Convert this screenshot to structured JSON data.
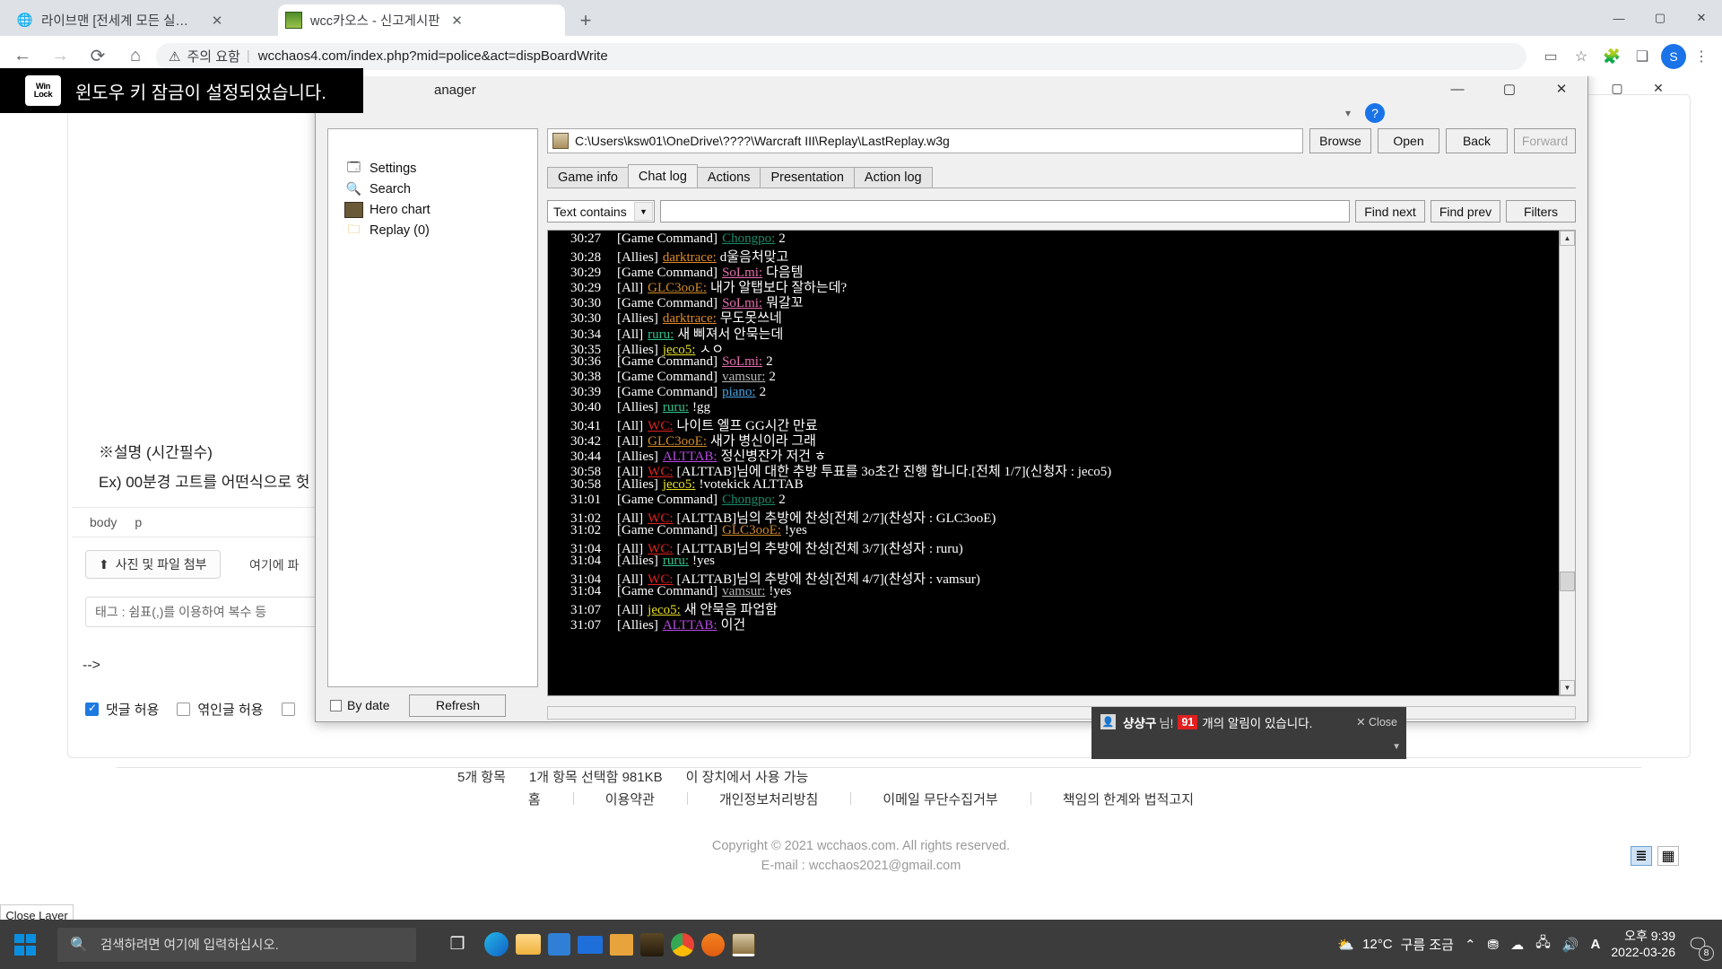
{
  "browser": {
    "tabs": [
      {
        "title": "라이브맨 [전세계 모든 실시간 스...",
        "favicon": "globe-icon",
        "active": false
      },
      {
        "title": "wcc카오스 - 신고게시판",
        "favicon": "site-icon",
        "active": true
      }
    ],
    "new_tab_label": "+",
    "window_controls": {
      "minimize": "—",
      "maximize": "▢",
      "close": "✕"
    },
    "nav": {
      "back": "←",
      "forward": "→",
      "reload": "⟳",
      "home": "⌂"
    },
    "omnibox": {
      "security_icon": "warning-triangle-icon",
      "security_label": "주의 요함",
      "url": "wcchaos4.com/index.php?mid=police&act=dispBoardWrite"
    },
    "omnibox_right_icons": [
      "payment-icon",
      "bookmark-star-icon",
      "extensions-icon",
      "split-view-icon"
    ],
    "profile_initial": "S"
  },
  "winlock_toast": {
    "badge_line1": "Win",
    "badge_line2": "Lock",
    "message": "윈도우 키 잠금이 설정되었습니다."
  },
  "page": {
    "note_title": "※설명 (시간필수)",
    "note_example": "Ex) 00분경 고트를 어떤식으로 헛",
    "body_tag": "body",
    "body_tag2": "p",
    "attach_button": "사진 및 파일 첨부",
    "attach_hint": "여기에 파",
    "tag_placeholder": "태그 : 쉼표(,)를 이용하여 복수 등",
    "arrow_text": "-->",
    "checkboxes": [
      {
        "label": "댓글 허용",
        "checked": true
      },
      {
        "label": "엮인글 허용",
        "checked": false
      },
      {
        "label": "",
        "checked": false
      }
    ],
    "status": [
      "5개 항목",
      "1개 항목 선택함 981KB",
      "이 장치에서 사용 가능"
    ],
    "footer_links": [
      "홈",
      "이용약관",
      "개인정보처리방침",
      "이메일 무단수집거부",
      "책임의 한계와 법적고지"
    ],
    "copyright_line1": "Copyright © 2021 wcchaos.com. All rights reserved.",
    "copyright_line2": "E-mail : wcchaos2021@gmail.com",
    "close_layer": "Close Layer"
  },
  "w3g": {
    "title": "anager",
    "window_controls": {
      "minimize": "—",
      "maximize": "▢",
      "close": "✕"
    },
    "tree": [
      {
        "label": "Settings",
        "icon": "settings-icon"
      },
      {
        "label": "Search",
        "icon": "magnifier-icon"
      },
      {
        "label": "Hero chart",
        "icon": "hero-chart-icon"
      },
      {
        "label": "Replay (0)",
        "icon": "folder-icon"
      }
    ],
    "by_date_label": "By date",
    "by_date_checked": false,
    "refresh_label": "Refresh",
    "path": "C:\\Users\\ksw01\\OneDrive\\????\\Warcraft III\\Replay\\LastReplay.w3g",
    "path_buttons": [
      {
        "label": "Browse",
        "disabled": false
      },
      {
        "label": "Open",
        "disabled": false
      },
      {
        "label": "Back",
        "disabled": false
      },
      {
        "label": "Forward",
        "disabled": true
      }
    ],
    "tabs": [
      {
        "label": "Game info",
        "active": false
      },
      {
        "label": "Chat log",
        "active": true
      },
      {
        "label": "Actions",
        "active": false
      },
      {
        "label": "Presentation",
        "active": false
      },
      {
        "label": "Action log",
        "active": false
      }
    ],
    "filter": {
      "mode": "Text contains",
      "query": "",
      "buttons": [
        "Find next",
        "Find prev",
        "Filters"
      ]
    },
    "chat_colors": {
      "darktrace": "#e08b28",
      "SoLmi": "#e86fb0",
      "GLC3ooE": "#d08a28",
      "ruru": "#2fc48e",
      "jeco5": "#e8e020",
      "vamsur": "#b8b8b8",
      "piano": "#4aa8e8",
      "WC": "#e02020",
      "ALTTAB": "#b44ae0",
      "Chongpo": "#1a8c6a"
    },
    "chat_lines": [
      {
        "time": "30:27",
        "channel": "[Game Command]",
        "name": "Chongpo",
        "color": "#1a8c6a",
        "msg": "2"
      },
      {
        "time": "30:28",
        "channel": "[Allies]",
        "name": "darktrace",
        "color": "#e08b28",
        "msg": "d울음처맞고"
      },
      {
        "time": "30:29",
        "channel": "[Game Command]",
        "name": "SoLmi",
        "color": "#e86fb0",
        "msg": "다음템"
      },
      {
        "time": "30:29",
        "channel": "[All]",
        "name": "GLC3ooE",
        "color": "#d08a28",
        "msg": "내가 알탭보다 잘하는데?"
      },
      {
        "time": "30:30",
        "channel": "[Game Command]",
        "name": "SoLmi",
        "color": "#e86fb0",
        "msg": "뭐갈꼬"
      },
      {
        "time": "30:30",
        "channel": "[Allies]",
        "name": "darktrace",
        "color": "#e08b28",
        "msg": "무도못쓰네"
      },
      {
        "time": "30:34",
        "channel": "[All]",
        "name": "ruru",
        "color": "#2fc48e",
        "msg": "새 삐져서 안묵는데"
      },
      {
        "time": "30:35",
        "channel": "[Allies]",
        "name": "jeco5",
        "color": "#e8e020",
        "msg": "ㅅㅇ"
      },
      {
        "time": "30:36",
        "channel": "[Game Command]",
        "name": "SoLmi",
        "color": "#e86fb0",
        "msg": "2"
      },
      {
        "time": "30:38",
        "channel": "[Game Command]",
        "name": "vamsur",
        "color": "#b8b8b8",
        "msg": "2"
      },
      {
        "time": "30:39",
        "channel": "[Game Command]",
        "name": "piano",
        "color": "#4aa8e8",
        "msg": "2"
      },
      {
        "time": "30:40",
        "channel": "[Allies]",
        "name": "ruru",
        "color": "#2fc48e",
        "msg": "!gg"
      },
      {
        "time": "30:41",
        "channel": "[All]",
        "name": "WC",
        "color": "#e02020",
        "msg": "나이트 엘프 GG시간 만료"
      },
      {
        "time": "30:42",
        "channel": "[All]",
        "name": "GLC3ooE",
        "color": "#d08a28",
        "msg": "새가 병신이라 그래"
      },
      {
        "time": "30:44",
        "channel": "[Allies]",
        "name": "ALTTAB",
        "color": "#b44ae0",
        "msg": "정신병잔가 저건 ㅎ"
      },
      {
        "time": "30:58",
        "channel": "[All]",
        "name": "WC",
        "color": "#e02020",
        "msg": "[ALTTAB]님에 대한 추방 투표를 3o초간 진행 합니다.[전체 1/7](신청자 : jeco5)"
      },
      {
        "time": "30:58",
        "channel": "[Allies]",
        "name": "jeco5",
        "color": "#e8e020",
        "msg": "!votekick ALTTAB"
      },
      {
        "time": "31:01",
        "channel": "[Game Command]",
        "name": "Chongpo",
        "color": "#1a8c6a",
        "msg": "2"
      },
      {
        "time": "31:02",
        "channel": "[All]",
        "name": "WC",
        "color": "#e02020",
        "msg": "[ALTTAB]님의 추방에 찬성[전체 2/7](찬성자 : GLC3ooE)"
      },
      {
        "time": "31:02",
        "channel": "[Game Command]",
        "name": "GLC3ooE",
        "color": "#d08a28",
        "msg": "!yes"
      },
      {
        "time": "31:04",
        "channel": "[All]",
        "name": "WC",
        "color": "#e02020",
        "msg": "[ALTTAB]님의 추방에 찬성[전체 3/7](찬성자 : ruru)"
      },
      {
        "time": "31:04",
        "channel": "[Allies]",
        "name": "ruru",
        "color": "#2fc48e",
        "msg": "!yes"
      },
      {
        "time": "31:04",
        "channel": "[All]",
        "name": "WC",
        "color": "#e02020",
        "msg": "[ALTTAB]님의 추방에 찬성[전체 4/7](찬성자 : vamsur)"
      },
      {
        "time": "31:04",
        "channel": "[Game Command]",
        "name": "vamsur",
        "color": "#b8b8b8",
        "msg": "!yes"
      },
      {
        "time": "31:07",
        "channel": "[All]",
        "name": "jeco5",
        "color": "#e8e020",
        "msg": "새 안묵음 파업함"
      },
      {
        "time": "31:07",
        "channel": "[Allies]",
        "name": "ALTTAB",
        "color": "#b44ae0",
        "msg": "이건"
      }
    ]
  },
  "notification": {
    "user": "샹샹구",
    "nim": "님!",
    "count": "91",
    "rest": "개의 알림이 있습니다.",
    "close": "Close"
  },
  "taskbar": {
    "search_placeholder": "검색하려면 여기에 입력하십시오.",
    "apps": [
      "task-view-icon",
      "edge-icon",
      "file-explorer-icon",
      "store-icon",
      "mail-icon",
      "notepad-icon",
      "game-icon",
      "chrome-icon",
      "avast-icon",
      "replay-manager-icon"
    ],
    "weather_temp": "12°C",
    "weather_desc": "구름 조금",
    "tray_icons": [
      "chevron-up-icon",
      "onedrive-sync-icon",
      "cloud-icon",
      "network-icon",
      "volume-icon",
      "ime-icon"
    ],
    "time": "오후 9:39",
    "date": "2022-03-26",
    "notification_count": "8"
  }
}
